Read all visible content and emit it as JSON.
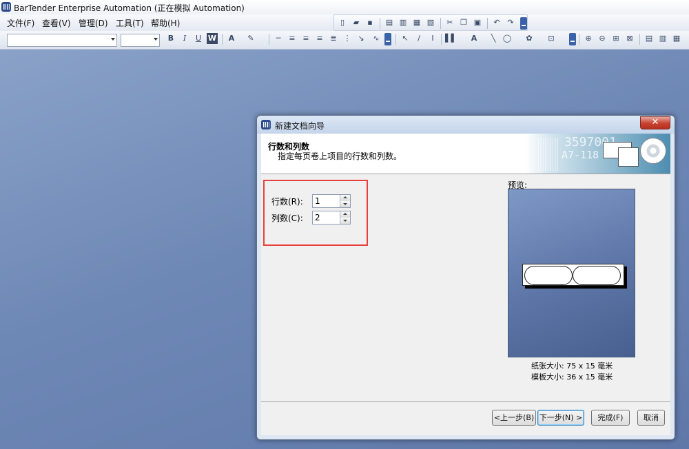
{
  "app": {
    "title": "BarTender Enterprise Automation (正在模拟 Automation)"
  },
  "menubar": {
    "items": [
      "文件(F)",
      "查看(V)",
      "管理(D)",
      "工具(T)",
      "帮助(H)"
    ]
  },
  "toolbar": {
    "font_name": "",
    "font_size": "",
    "bold": "B",
    "italic": "I",
    "underline": "U",
    "word": "W",
    "text_tool": "A",
    "cursor_tool": "I"
  },
  "dialog": {
    "title": "新建文档向导",
    "heading": "行数和列数",
    "subheading": "指定每页卷上项目的行数和列数。",
    "banner_text_1": "3597001",
    "banner_text_2": "A7-118",
    "rows_label": "行数(R):",
    "rows_value": "1",
    "columns_label": "列数(C):",
    "columns_value": "2",
    "preview_label": "预览:",
    "paper_size": "纸张大小:  75 x 15 毫米",
    "template_size": "模板大小:  36 x 15 毫米",
    "back_button": "<上一步(B)",
    "next_button": "下一步(N) >",
    "finish_button": "完成(F)",
    "cancel_button": "取消",
    "close_glyph": "✕"
  },
  "preview": {
    "rows": 1,
    "columns": 2
  }
}
